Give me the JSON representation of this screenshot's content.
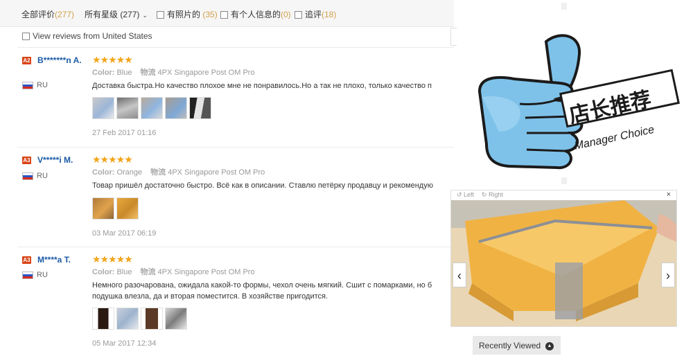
{
  "filters": {
    "all_label": "全部评价",
    "all_count": "(277)",
    "stars_label": "所有星级",
    "stars_count": "(277)",
    "photos_label": "有照片的",
    "photos_count": "(35)",
    "personal_label": "有个人信息的",
    "personal_count": "(0)",
    "followup_label": "追评",
    "followup_count": "(18)",
    "us_label": "View reviews from United States"
  },
  "reviews": [
    {
      "badge": "A2",
      "name": "B*******n A.",
      "country": "RU",
      "stars": "★★★★★",
      "color_label": "Color:",
      "color_value": "Blue",
      "shipping_label": "物流",
      "shipping_value": "4PX Singapore Post OM Pro",
      "text": "Доставка быстра.Но качество плохое мне не понравилось.Но а так не плохо, только качество п",
      "date": "27 Feb 2017 01:16"
    },
    {
      "badge": "A3",
      "name": "V*****i M.",
      "country": "RU",
      "stars": "★★★★★",
      "color_label": "Color:",
      "color_value": "Orange",
      "shipping_label": "物流",
      "shipping_value": "4PX Singapore Post OM Pro",
      "text": "Товар пришёл достаточно быстро. Всё как в описании. Ставлю петёрку продавцу и рекомендую",
      "date": "03 Mar 2017 06:19"
    },
    {
      "badge": "A3",
      "name": "M****a T.",
      "country": "RU",
      "stars": "★★★★★",
      "color_label": "Color:",
      "color_value": "Blue",
      "shipping_label": "物流",
      "shipping_value": "4PX Singapore Post OM Pro",
      "text": "Немного разочарована, ожидала какой-то формы, чехол очень мягкий. Сшит с помарками, но б",
      "text2": "подушка влезла, да и вторая поместится. В хозяйстве пригодится.",
      "date": "05 Mar 2017 12:34"
    }
  ],
  "manager_choice": {
    "title_cn": "店长推荐",
    "title_en": "Manager Choice"
  },
  "viewer": {
    "left_label": "Left",
    "right_label": "Right",
    "close": "×",
    "prev": "‹",
    "next": "›"
  },
  "recently_viewed": {
    "label": "Recently Viewed",
    "icon": "chevron-up-icon"
  },
  "colors": {
    "star": "#f3a41a",
    "username": "#1a5aa6",
    "count": "#d2a04a",
    "badge": "#d84315",
    "thumb_blue": "#7fb0ea"
  }
}
